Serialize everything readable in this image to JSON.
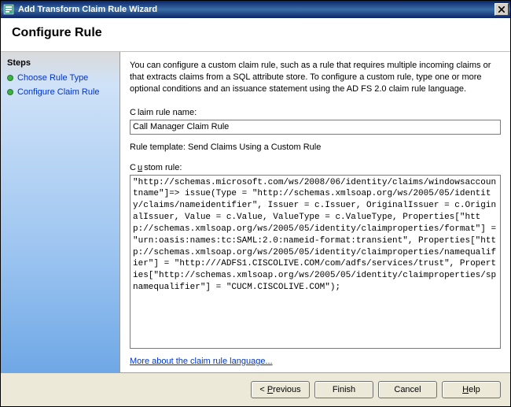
{
  "window": {
    "title": "Add Transform Claim Rule Wizard"
  },
  "header": {
    "title": "Configure Rule"
  },
  "sidebar": {
    "heading": "Steps",
    "items": [
      {
        "label": "Choose Rule Type"
      },
      {
        "label": "Configure Claim Rule"
      }
    ]
  },
  "content": {
    "intro": "You can configure a custom claim rule, such as a rule that requires multiple incoming claims or that extracts claims from a SQL attribute store. To configure a custom rule, type one or more optional conditions and an issuance statement using the AD FS 2.0 claim rule language.",
    "rule_name_label_prefix": "C",
    "rule_name_label_rest": "laim rule name:",
    "rule_name_value": "Call Manager Claim Rule",
    "template_label": "Rule template: Send Claims Using a Custom Rule",
    "custom_rule_label_prefix": "C",
    "custom_rule_label_u": "u",
    "custom_rule_label_rest": "stom rule:",
    "custom_rule_value": "\"http://schemas.microsoft.com/ws/2008/06/identity/claims/windowsaccountname\"]=> issue(Type = \"http://schemas.xmlsoap.org/ws/2005/05/identity/claims/nameidentifier\", Issuer = c.Issuer, OriginalIssuer = c.OriginalIssuer, Value = c.Value, ValueType = c.ValueType, Properties[\"http://schemas.xmlsoap.org/ws/2005/05/identity/claimproperties/format\"] = \"urn:oasis:names:tc:SAML:2.0:nameid-format:transient\", Properties[\"http://schemas.xmlsoap.org/ws/2005/05/identity/claimproperties/namequalifier\"] = \"http:///ADFS1.CISCOLIVE.COM/com/adfs/services/trust\", Properties[\"http://schemas.xmlsoap.org/ws/2005/05/identity/claimproperties/spnamequalifier\"] = \"CUCM.CISCOLIVE.COM\");",
    "help_link": "More about the claim rule language..."
  },
  "footer": {
    "previous_p": "P",
    "previous_rest": "revious",
    "previous_prefix": "< ",
    "finish": "Finish",
    "cancel": "Cancel",
    "help_u": "H",
    "help_rest": "elp"
  }
}
